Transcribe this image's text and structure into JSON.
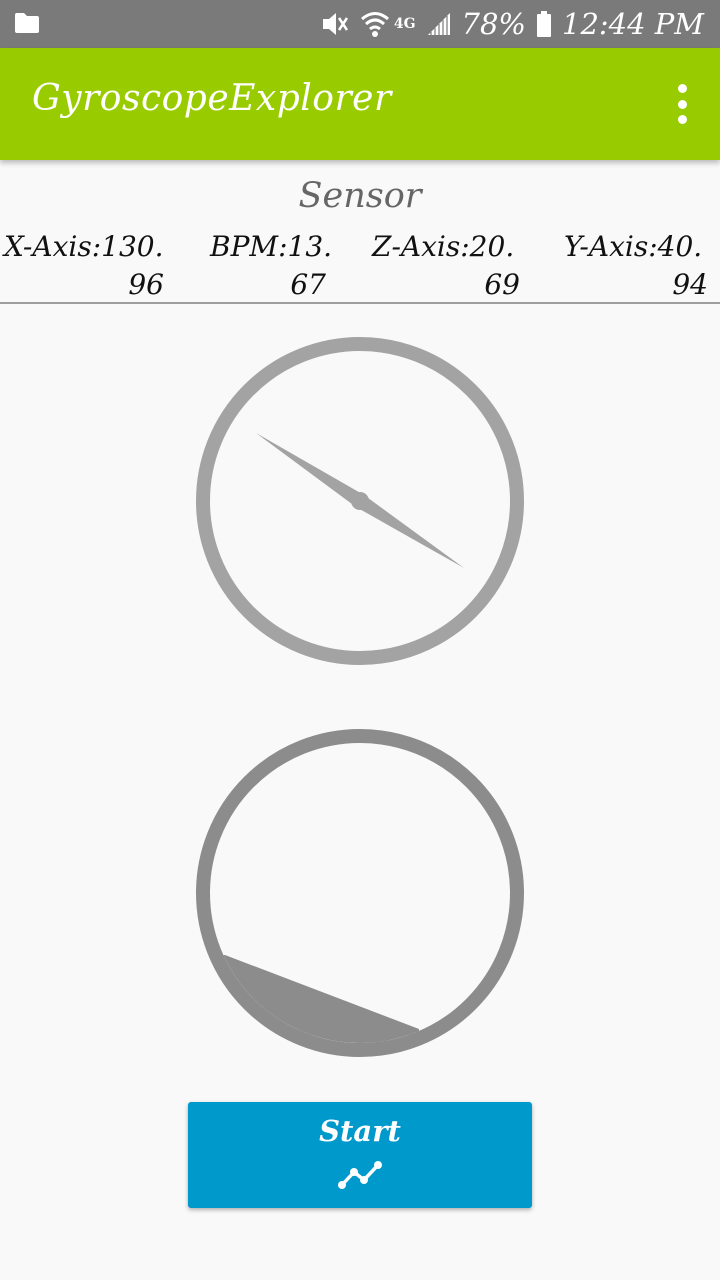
{
  "status_bar": {
    "battery_percent": "78%",
    "time": "12:44 PM",
    "network": "4G",
    "icons": [
      "folder-icon",
      "mute-icon",
      "wifi-icon",
      "signal-icon",
      "battery-icon"
    ]
  },
  "app_bar": {
    "title": "GyroscopeExplorer",
    "menu_icon": "overflow-menu-icon",
    "color": "#99cc00"
  },
  "sensor": {
    "title": "Sensor",
    "readings": [
      {
        "line1": "X-Axis:130.",
        "line2": "96"
      },
      {
        "line1": "BPM:13.",
        "line2": "67"
      },
      {
        "line1": "Z-Axis:20.",
        "line2": "69"
      },
      {
        "line1": "Y-Axis:40.",
        "line2": "94"
      }
    ]
  },
  "gauges": {
    "compass_icon": "compass-needle-icon",
    "tilt_icon": "attitude-indicator-icon"
  },
  "start_button": {
    "label": "Start",
    "icon": "line-chart-icon",
    "color": "#0099cc"
  }
}
